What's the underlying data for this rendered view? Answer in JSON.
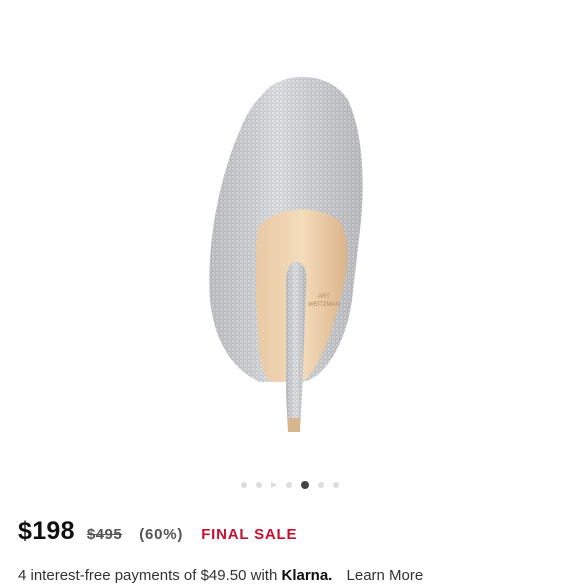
{
  "gallery": {
    "image_alt": "Silver glitter pointed-toe pump, rear view",
    "dot_count": 7,
    "active_index": 4,
    "video_index": 2
  },
  "price": {
    "current": "$198",
    "original": "$495",
    "discount": "(60%)",
    "badge": "FINAL SALE",
    "badge_color": "#c8102e"
  },
  "installments": {
    "text": "4 interest-free payments of $49.50 with",
    "provider": "Klarna.",
    "link": "Learn More"
  },
  "brand_mark": [
    "ART",
    "WEITZMAN"
  ]
}
